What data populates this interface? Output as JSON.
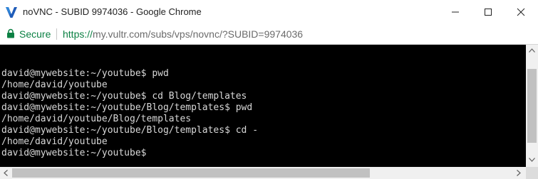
{
  "window": {
    "title": "noVNC - SUBID 9974036 - Google Chrome",
    "app_icon": "vultr-logo-icon",
    "buttons": [
      "minimize-icon",
      "maximize-icon",
      "close-icon"
    ]
  },
  "address_bar": {
    "security_label": "Secure",
    "url_scheme": "https://",
    "url_rest": "my.vultr.com/subs/vps/novnc/?SUBID=9974036"
  },
  "terminal": {
    "lines": [
      "david@mywebsite:~/youtube$ pwd",
      "/home/david/youtube",
      "david@mywebsite:~/youtube$ cd Blog/templates",
      "david@mywebsite:~/youtube/Blog/templates$ pwd",
      "/home/david/youtube/Blog/templates",
      "david@mywebsite:~/youtube/Blog/templates$ cd -",
      "/home/david/youtube",
      "david@mywebsite:~/youtube$"
    ]
  },
  "colors": {
    "terminal_background": "#000000",
    "terminal_text": "#d8d8d8",
    "secure_green": "#0b8043",
    "logo_blue": "#1e5bb8"
  }
}
